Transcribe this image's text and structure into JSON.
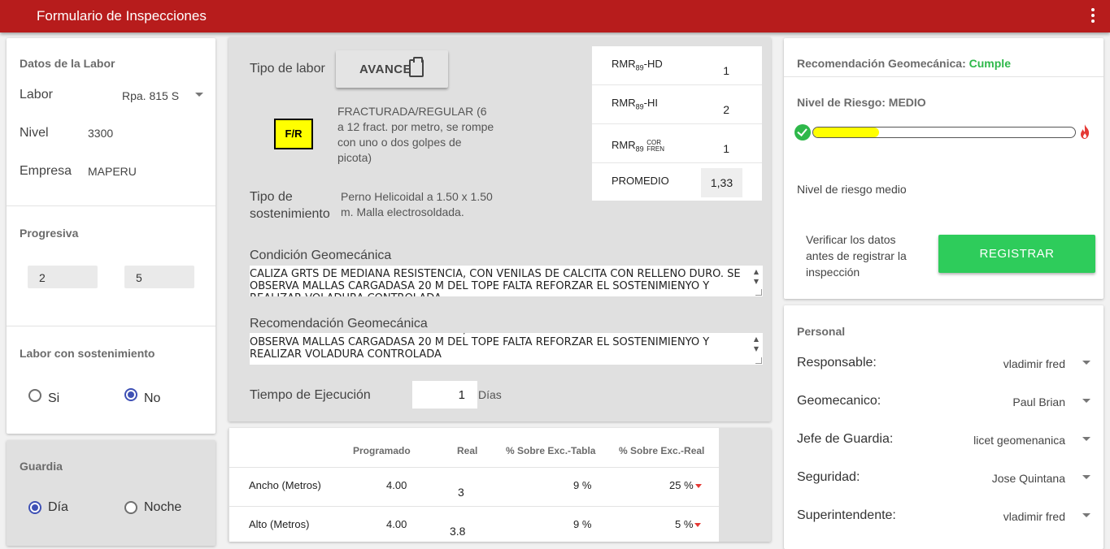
{
  "app": {
    "title": "Formulario de Inspecciones"
  },
  "datos_labor": {
    "title": "Datos de la Labor",
    "labor_label": "Labor",
    "labor_value": "Rpa. 815 S",
    "nivel_label": "Nivel",
    "nivel_value": "3300",
    "empresa_label": "Empresa",
    "empresa_value": "MAPERU"
  },
  "progresiva": {
    "title": "Progresiva",
    "value_1": "2",
    "value_2": "5"
  },
  "sostenimiento": {
    "title": "Labor con sostenimiento",
    "opt_si": "Si",
    "opt_no": "No",
    "selected": "No"
  },
  "guardia": {
    "title": "Guardia",
    "opt_dia": "Día",
    "opt_noche": "Noche",
    "selected": "Día"
  },
  "labor": {
    "tipo_label": "Tipo de labor",
    "tipo_button": "AVANCE",
    "badge": "F/R",
    "badge_color": "#ffff00",
    "badge_desc": "FRACTURADA/REGULAR (6 a 12 fract. por metro, se rompe con uno o dos golpes de picota)",
    "sost_label": "Tipo de sostenimiento",
    "sost_value": "Perno Helicoidal a 1.50 x 1.50 m. Malla electrosoldada."
  },
  "rmr": {
    "base": "RMR",
    "sub": "89",
    "rows": [
      {
        "suffix": "-HD",
        "value": "1"
      },
      {
        "suffix": "-HI",
        "value": "2"
      },
      {
        "sup": "COR",
        "sub2": "FREN",
        "value": "1"
      }
    ],
    "promedio_label": "PROMEDIO",
    "promedio_value": "1,33"
  },
  "condicion": {
    "label": "Condición Geomecánica",
    "text": "CALIZA GRTS DE MEDIANA RESISTENCIA, CON VENILAS DE CALCITA CON RELLENO DURO. SE OBSERVA MALLAS CARGADASA 20 M DEL TOPE FALTA REFORZAR EL SOSTENIMIENYO Y REALIZAR VOLADURA CONTROLADA"
  },
  "recomendacion": {
    "label": "Recomendación Geomecánica",
    "text": "CALIZA GRTS DE MEDIANA RESISTENCIA, CON VENILAS DE CALCITA CON RELLENO DURO. SE OBSERVA MALLAS CARGADASA 20 M DEL TOPE FALTA REFORZAR EL SOSTENIMIENYO Y REALIZAR VOLADURA CONTROLADA"
  },
  "tiempo": {
    "label": "Tiempo de Ejecución",
    "value": "1",
    "unit": "Días"
  },
  "tabla": {
    "headers": [
      "Programado",
      "Real",
      "% Sobre Exc.-Tabla",
      "% Sobre Exc.-Real"
    ],
    "rows": [
      {
        "name": "Ancho (Metros)",
        "programado": "4.00",
        "real": "3",
        "tabla": "9 %",
        "real_pct": "25 %"
      },
      {
        "name": "Alto (Metros)",
        "programado": "4.00",
        "real": "3.8",
        "tabla": "9 %",
        "real_pct": "5 %"
      }
    ]
  },
  "resultado": {
    "recomendacion_label": "Recomendación Geomecánica:",
    "recomendacion_value": "Cumple",
    "cumple_color": "#2eb84a",
    "riesgo_title": "Nivel de Riesgo: MEDIO",
    "riesgo_level": 0.25,
    "riesgo_color": "#ffff00",
    "riesgo_text": "Nivel de riesgo medio",
    "verificar_text": "Verificar los datos antes de registrar la inspección",
    "registrar_button": "REGISTRAR"
  },
  "personal": {
    "title": "Personal",
    "fields": [
      {
        "label": "Responsable:",
        "value": "vladimir fred"
      },
      {
        "label": "Geomecanico:",
        "value": "Paul Brian"
      },
      {
        "label": "Jefe de Guardia:",
        "value": "licet geomenanica"
      },
      {
        "label": "Seguridad:",
        "value": "Jose Quintana"
      },
      {
        "label": "Superintendente:",
        "value": "vladimir fred"
      }
    ]
  }
}
